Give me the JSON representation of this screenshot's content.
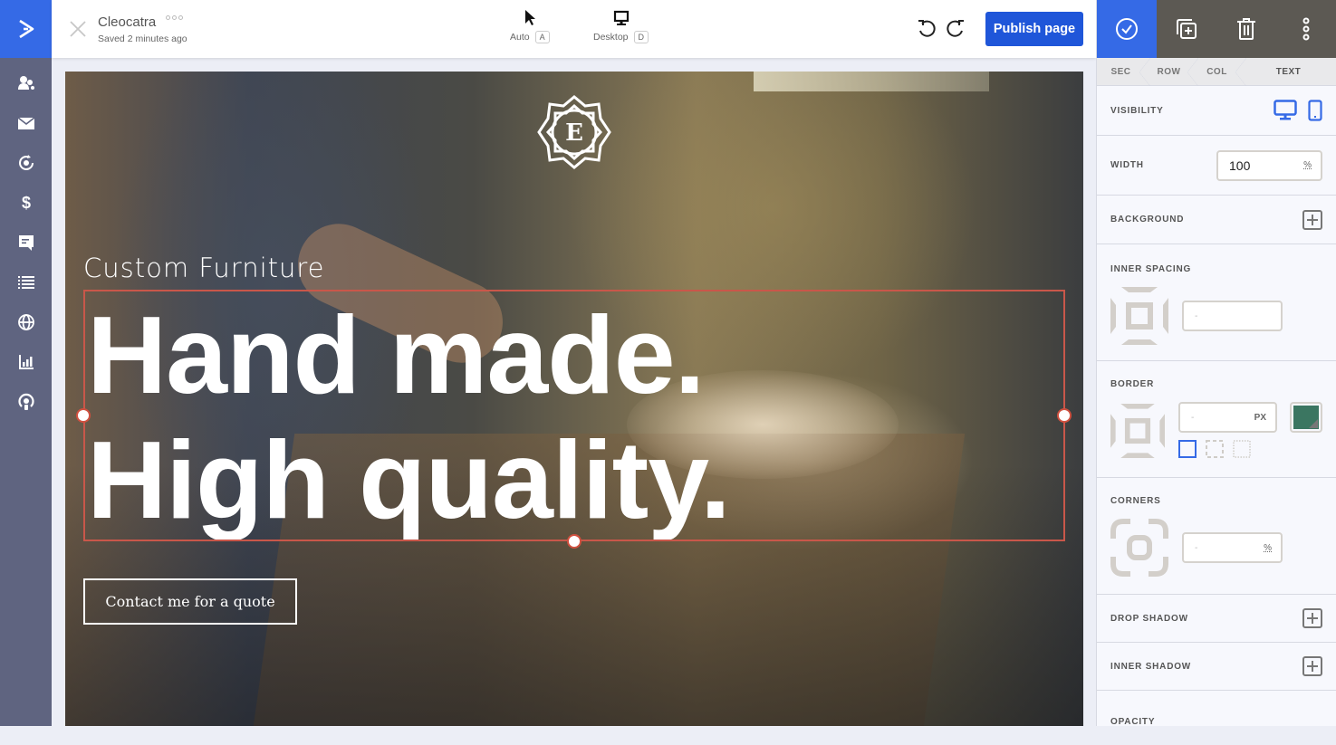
{
  "app": {
    "page_name": "Cleocatra",
    "saved_status": "Saved 2 minutes ago"
  },
  "nav": {
    "brand_icon": "chevron-right-logo",
    "items": [
      {
        "name": "contacts",
        "icon": "contacts-icon"
      },
      {
        "name": "campaigns",
        "icon": "envelope-icon"
      },
      {
        "name": "automations",
        "icon": "automation-gear-icon"
      },
      {
        "name": "deals",
        "icon": "dollar-icon"
      },
      {
        "name": "conversations",
        "icon": "chat-icon"
      },
      {
        "name": "lists",
        "icon": "list-icon"
      },
      {
        "name": "website",
        "icon": "globe-icon"
      },
      {
        "name": "reports",
        "icon": "bar-chart-icon"
      },
      {
        "name": "apps",
        "icon": "location-pin-icon"
      }
    ]
  },
  "toolbar": {
    "modes": [
      {
        "label": "Auto",
        "shortcut": "A",
        "icon": "cursor-icon"
      },
      {
        "label": "Desktop",
        "shortcut": "D",
        "icon": "desktop-icon"
      }
    ],
    "publish_label": "Publish page"
  },
  "canvas": {
    "logo_letter": "E",
    "subheading": "Custom Furniture",
    "headline_line1": "Hand made.",
    "headline_line2": "High quality.",
    "cta_label": "Contact me for a quote",
    "selection_color": "#c9574a"
  },
  "panel": {
    "tools": [
      "confirm-icon",
      "duplicate-icon",
      "trash-icon",
      "more-vertical-icon"
    ],
    "breadcrumbs": [
      "SEC",
      "ROW",
      "COL",
      "TEXT"
    ],
    "visibility": {
      "label": "VISIBILITY",
      "desktop": true,
      "mobile": true
    },
    "width": {
      "label": "WIDTH",
      "value": "100",
      "unit": "%"
    },
    "background": {
      "label": "BACKGROUND"
    },
    "inner_spacing": {
      "label": "INNER SPACING",
      "placeholder": "-"
    },
    "border": {
      "label": "BORDER",
      "placeholder": "-",
      "unit": "PX",
      "color": "#3b7661",
      "styles": [
        "solid",
        "dashed",
        "dotted"
      ],
      "selected_style": "solid"
    },
    "corners": {
      "label": "CORNERS",
      "placeholder": "-",
      "unit": "%"
    },
    "drop_shadow": {
      "label": "DROP SHADOW"
    },
    "inner_shadow": {
      "label": "INNER SHADOW"
    },
    "opacity": {
      "label": "OPACITY"
    }
  },
  "colors": {
    "brand_blue": "#356ae6",
    "publish_blue": "#1f56d9",
    "nav_bg": "#5f6480",
    "panel_toolbar_bg": "#5c5953"
  }
}
